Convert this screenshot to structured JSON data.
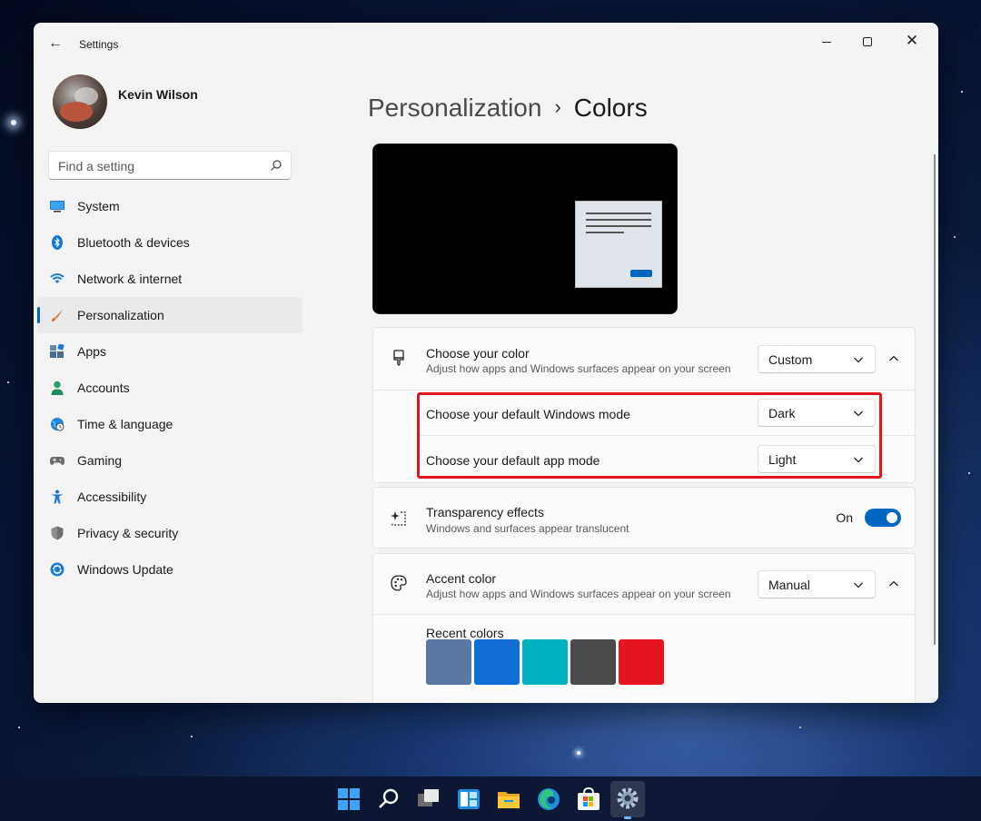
{
  "window": {
    "title": "Settings",
    "back": "←",
    "close": "✕"
  },
  "user": {
    "name": "Kevin Wilson"
  },
  "search": {
    "placeholder": "Find a setting"
  },
  "nav": {
    "items": [
      {
        "label": "System",
        "icon": "monitor-icon"
      },
      {
        "label": "Bluetooth & devices",
        "icon": "bluetooth-icon"
      },
      {
        "label": "Network & internet",
        "icon": "wifi-icon"
      },
      {
        "label": "Personalization",
        "icon": "brush-icon",
        "active": true
      },
      {
        "label": "Apps",
        "icon": "apps-icon"
      },
      {
        "label": "Accounts",
        "icon": "person-icon"
      },
      {
        "label": "Time & language",
        "icon": "globe-clock-icon"
      },
      {
        "label": "Gaming",
        "icon": "controller-icon"
      },
      {
        "label": "Accessibility",
        "icon": "accessibility-icon"
      },
      {
        "label": "Privacy & security",
        "icon": "shield-icon"
      },
      {
        "label": "Windows Update",
        "icon": "update-icon"
      }
    ]
  },
  "breadcrumb": {
    "parent": "Personalization",
    "sep": "›",
    "current": "Colors"
  },
  "choose_color": {
    "title": "Choose your color",
    "subtitle": "Adjust how apps and Windows surfaces appear on your screen",
    "value": "Custom"
  },
  "windows_mode": {
    "title": "Choose your default Windows mode",
    "value": "Dark"
  },
  "app_mode": {
    "title": "Choose your default app mode",
    "value": "Light"
  },
  "transparency": {
    "title": "Transparency effects",
    "subtitle": "Windows and surfaces appear translucent",
    "state": "On"
  },
  "accent": {
    "title": "Accent color",
    "subtitle": "Adjust how apps and Windows surfaces appear on your screen",
    "value": "Manual",
    "recent_label": "Recent colors",
    "recent_colors": [
      "#5b77a3",
      "#0f6fd4",
      "#00b3c2",
      "#4a4a4a",
      "#e6151f"
    ]
  },
  "colors": {
    "accent": "#0067c0",
    "highlight": "#e0141e"
  }
}
